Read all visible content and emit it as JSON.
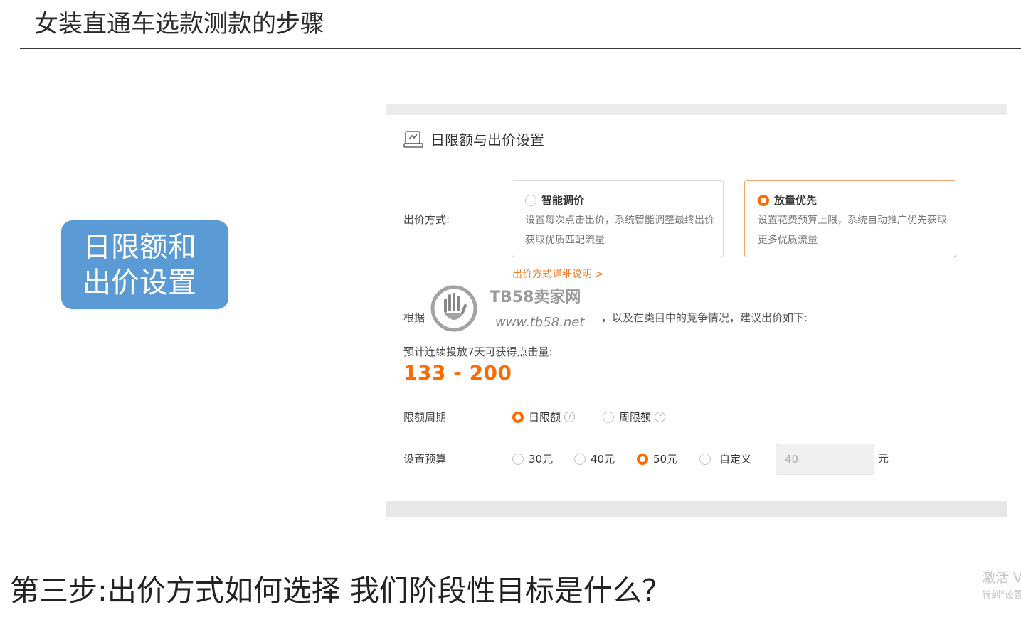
{
  "slide": {
    "title": "女装直通车选款测款的步骤",
    "callout": "日限额和出价设置",
    "bottom_caption": "第三步:出价方式如何选择  我们阶段性目标是什么？",
    "activation_line1": "激活 V",
    "activation_line2": "转到\"设置"
  },
  "panel": {
    "header_title": "日限额与出价设置",
    "bid_method_label": "出价方式:",
    "bid_options": [
      {
        "title": "智能调价",
        "desc": "设置每次点击出价，系统智能调整最终出价获取优质匹配流量",
        "selected": false
      },
      {
        "title": "放量优先",
        "desc": "设置花费预算上限，系统自动推广优先获取更多优质流量",
        "selected": true
      }
    ],
    "detail_link": "出价方式详细说明 >",
    "suggest_text_head": "根据",
    "suggest_text_tail": "，以及在类目中的竞争情况，建议出价如下:",
    "forecast_label": "预计连续投放7天可获得点击量:",
    "forecast_value": "133 - 200",
    "period_label": "限额周期",
    "period_options": [
      {
        "label": "日限额",
        "selected": true
      },
      {
        "label": "周限额",
        "selected": false
      }
    ],
    "budget_label": "设置预算",
    "budget_options": [
      {
        "label": "30元",
        "selected": false
      },
      {
        "label": "40元",
        "selected": false
      },
      {
        "label": "50元",
        "selected": true
      },
      {
        "label": "自定义",
        "selected": false
      }
    ],
    "budget_input_value": "40",
    "budget_unit": "元",
    "help_glyph": "?"
  },
  "watermark": {
    "brand": "TB58卖家网",
    "url": "www.tb58.net"
  },
  "colors": {
    "accent_orange": "#ff6a00",
    "callout_blue": "#5b9bd5",
    "link_orange": "#f07a1f"
  }
}
